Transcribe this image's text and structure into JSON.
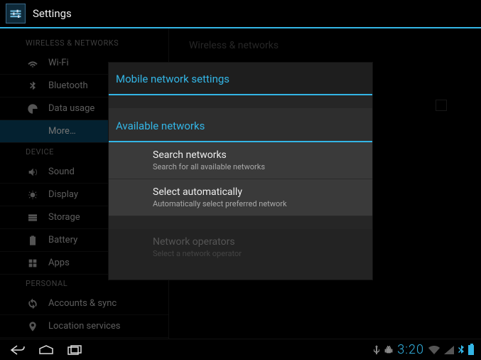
{
  "app": {
    "title": "Settings"
  },
  "sidebar": {
    "categories": {
      "wireless": "WIRELESS & NETWORKS",
      "device": "DEVICE",
      "personal": "PERSONAL"
    },
    "items": {
      "wifi": "Wi-Fi",
      "bluetooth": "Bluetooth",
      "data_usage": "Data usage",
      "more": "More…",
      "sound": "Sound",
      "display": "Display",
      "storage": "Storage",
      "battery": "Battery",
      "apps": "Apps",
      "accounts_sync": "Accounts & sync",
      "location": "Location services"
    }
  },
  "detail": {
    "breadcrumb": "Wireless & networks"
  },
  "dialog": {
    "title": "Mobile network settings",
    "section": "Available networks",
    "items": [
      {
        "primary": "Search networks",
        "secondary": "Search for all available networks"
      },
      {
        "primary": "Select automatically",
        "secondary": "Automatically select preferred network"
      }
    ],
    "disabled": {
      "primary": "Network operators",
      "secondary": "Select a network operator"
    }
  },
  "status_bar": {
    "clock": "3:20"
  }
}
